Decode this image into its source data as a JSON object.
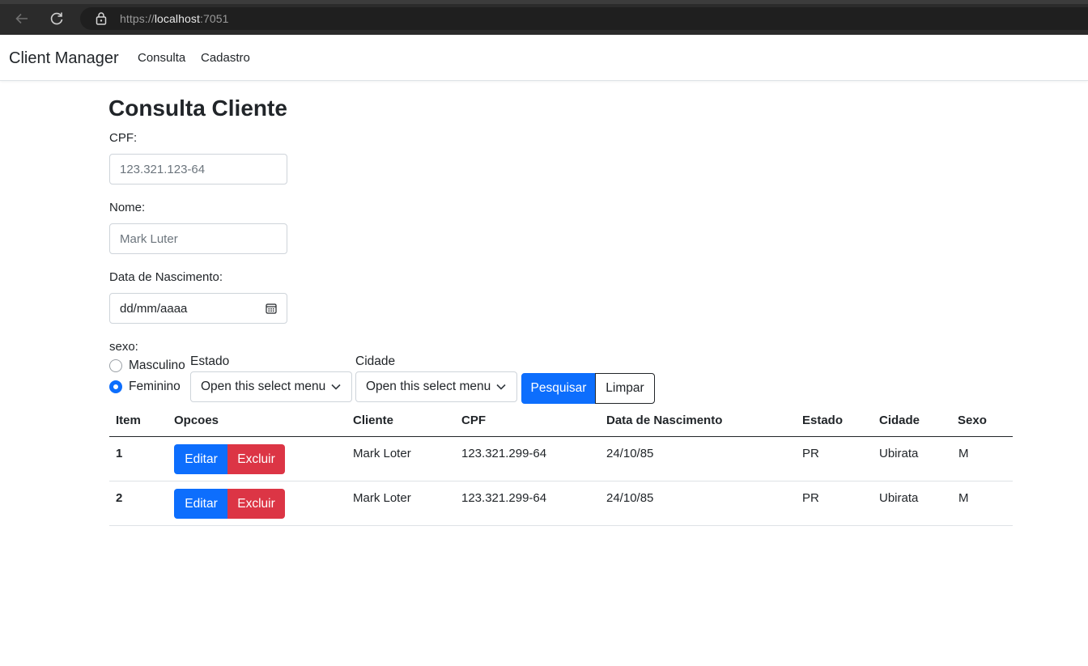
{
  "browser": {
    "url_scheme": "https://",
    "url_host": "localhost",
    "url_port": ":7051",
    "icons": {
      "back": "arrow-left-icon",
      "reload": "reload-icon",
      "lock": "lock-icon"
    }
  },
  "navbar": {
    "brand": "Client Manager",
    "links": [
      "Consulta",
      "Cadastro"
    ]
  },
  "form": {
    "title": "Consulta Cliente",
    "cpf": {
      "label": "CPF:",
      "placeholder": "123.321.123-64"
    },
    "nome": {
      "label": "Nome:",
      "placeholder": "Mark Luter"
    },
    "nascimento": {
      "label": "Data de Nascimento:",
      "value": "dd/mm/aaaa",
      "icon": "calendar-icon"
    },
    "sexo": {
      "label": "sexo:",
      "options": [
        {
          "label": "Masculino",
          "checked": false
        },
        {
          "label": "Feminino",
          "checked": true
        }
      ]
    },
    "estado": {
      "label": "Estado",
      "selected": "Open this select menu"
    },
    "cidade": {
      "label": "Cidade",
      "selected": "Open this select menu"
    },
    "buttons": {
      "search": "Pesquisar",
      "clear": "Limpar"
    },
    "colors": {
      "primary": "#0d6efd",
      "danger": "#dc3545"
    }
  },
  "table": {
    "headers": [
      "Item",
      "Opcoes",
      "Cliente",
      "CPF",
      "Data de Nascimento",
      "Estado",
      "Cidade",
      "Sexo"
    ],
    "edit_label": "Editar",
    "delete_label": "Excluir",
    "rows": [
      {
        "item": "1",
        "cliente": "Mark Loter",
        "cpf": "123.321.299-64",
        "nascimento": "24/10/85",
        "estado": "PR",
        "cidade": "Ubirata",
        "sexo": "M"
      },
      {
        "item": "2",
        "cliente": "Mark Loter",
        "cpf": "123.321.299-64",
        "nascimento": "24/10/85",
        "estado": "PR",
        "cidade": "Ubirata",
        "sexo": "M"
      }
    ]
  }
}
